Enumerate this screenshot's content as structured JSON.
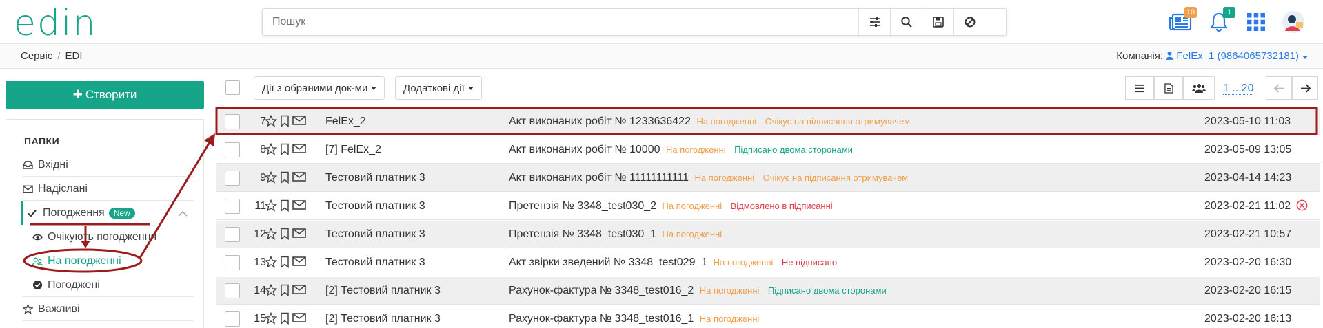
{
  "header": {
    "logo_text": "edin",
    "search_placeholder": "Пошук",
    "badges": {
      "news": "10",
      "notifications": "1"
    },
    "accent_color": "#17a589"
  },
  "breadcrumb": {
    "items": [
      "Сервіс",
      "EDI"
    ]
  },
  "company": {
    "label": "Компанія:",
    "value": "FelEx_1 (9864065732181)"
  },
  "sidebar": {
    "create_label": "Створити",
    "folders_title": "ПАПКИ",
    "items": [
      {
        "label": "Вхідні",
        "icon": "inbox-icon"
      },
      {
        "label": "Надіслані",
        "icon": "envelope-icon"
      },
      {
        "label": "Погодження",
        "icon": "check-icon",
        "badge": "New"
      },
      {
        "label": "Очікують погодження",
        "icon": "eye-icon"
      },
      {
        "label": "На погодженні",
        "icon": "users-icon"
      },
      {
        "label": "Погоджені",
        "icon": "check-circle-icon"
      },
      {
        "label": "Важливі",
        "icon": "star-icon"
      }
    ]
  },
  "toolbar": {
    "bulk_actions": "Дії з обраними док-ми",
    "extra_actions": "Додаткові дії",
    "pager": "1 ...20"
  },
  "rows": [
    {
      "num": "7",
      "counterparty": "FelEx_2",
      "document": "Акт виконаних робіт № 1233636422",
      "status1": "На погодженні",
      "status2": "Очікує на підписання отримувачем",
      "status2_color": "#f0a04b",
      "date": "2023-05-10 11:03"
    },
    {
      "num": "8",
      "counterparty": "[7] FelEx_2",
      "document": "Акт виконаних робіт № 10000",
      "status1": "На погодженні",
      "status2": "Підписано двома сторонами",
      "status2_color": "#17a589",
      "date": "2023-05-09 13:05"
    },
    {
      "num": "9",
      "counterparty": "Тестовий платник 3",
      "document": "Акт виконаних робіт № 11111111111",
      "status1": "На погодженні",
      "status2": "Очікує на підписання отримувачем",
      "status2_color": "#f0a04b",
      "date": "2023-04-14 14:23"
    },
    {
      "num": "11",
      "counterparty": "Тестовий платник 3",
      "document": "Претензія № 3348_test030_2",
      "status1": "На погодженні",
      "status2": "Відмовлено в підписанні",
      "status2_color": "#e23d4c",
      "date": "2023-02-21 11:02",
      "error": true
    },
    {
      "num": "12",
      "counterparty": "Тестовий платник 3",
      "document": "Претензія № 3348_test030_1",
      "status1": "На погодженні",
      "status2": "",
      "status2_color": "#f0a04b",
      "date": "2023-02-21 10:57"
    },
    {
      "num": "13",
      "counterparty": "Тестовий платник 3",
      "document": "Акт звірки зведений № 3348_test029_1",
      "status1": "На погодженні",
      "status2": "Не підписано",
      "status2_color": "#e23d4c",
      "date": "2023-02-20 16:30"
    },
    {
      "num": "14",
      "counterparty": "[2] Тестовий платник 3",
      "document": "Рахунок-фактура № 3348_test016_2",
      "status1": "На погодженні",
      "status2": "Підписано двома сторонами",
      "status2_color": "#17a589",
      "date": "2023-02-20 16:15"
    },
    {
      "num": "15",
      "counterparty": "[2] Тестовий платник 3",
      "document": "Рахунок-фактура № 3348_test016_1",
      "status1": "На погодженні",
      "status2": "",
      "status2_color": "#f0a04b",
      "date": "2023-02-20 16:13"
    }
  ]
}
